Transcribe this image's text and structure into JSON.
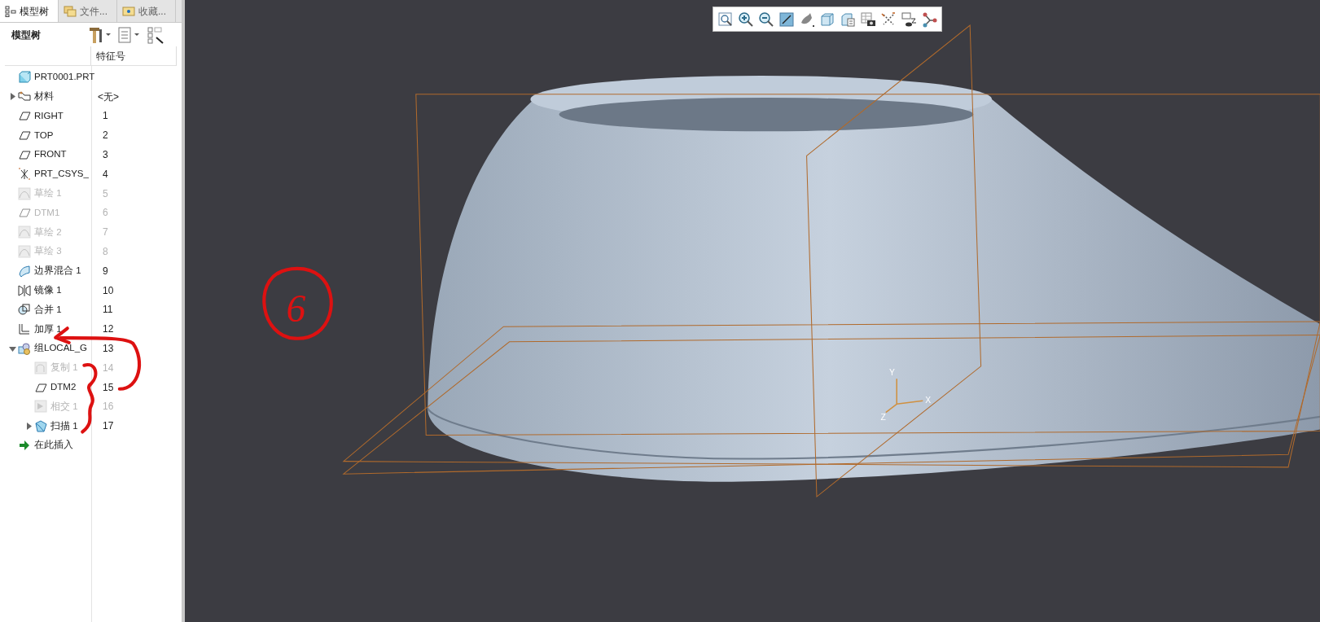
{
  "tabs": [
    {
      "label": "模型树",
      "selected": true
    },
    {
      "label": "文件...",
      "selected": false
    },
    {
      "label": "收藏...",
      "selected": false
    }
  ],
  "tree_toolbar": {
    "title": "模型树"
  },
  "tree": {
    "columns": [
      "特征号"
    ],
    "items": [
      {
        "kind": "part",
        "label": "PRT0001.PRT",
        "disabled": false
      },
      {
        "kind": "material",
        "label": "材料",
        "feature_no": "<无>",
        "disabled": false,
        "expanded": false
      },
      {
        "kind": "plane",
        "label": "RIGHT",
        "feature_no": "1",
        "disabled": false
      },
      {
        "kind": "plane",
        "label": "TOP",
        "feature_no": "2",
        "disabled": false
      },
      {
        "kind": "plane",
        "label": "FRONT",
        "feature_no": "3",
        "disabled": false
      },
      {
        "kind": "csys",
        "label": "PRT_CSYS_",
        "feature_no": "4",
        "disabled": false
      },
      {
        "kind": "sketch",
        "label": "草绘 1",
        "feature_no": "5",
        "disabled": true
      },
      {
        "kind": "plane",
        "label": "DTM1",
        "feature_no": "6",
        "disabled": true
      },
      {
        "kind": "sketch",
        "label": "草绘 2",
        "feature_no": "7",
        "disabled": true
      },
      {
        "kind": "sketch",
        "label": "草绘 3",
        "feature_no": "8",
        "disabled": true
      },
      {
        "kind": "blend",
        "label": "边界混合 1",
        "feature_no": "9",
        "disabled": false
      },
      {
        "kind": "mirror",
        "label": "镜像 1",
        "feature_no": "10",
        "disabled": false
      },
      {
        "kind": "merge",
        "label": "合并 1",
        "feature_no": "11",
        "disabled": false
      },
      {
        "kind": "thicken",
        "label": "加厚 1",
        "feature_no": "12",
        "disabled": false
      },
      {
        "kind": "group",
        "label": "组LOCAL_G",
        "feature_no": "13",
        "disabled": false,
        "expanded": true,
        "children": [
          {
            "kind": "copy",
            "label": "复制 1",
            "feature_no": "14",
            "disabled": true
          },
          {
            "kind": "plane",
            "label": "DTM2",
            "feature_no": "15",
            "disabled": false
          },
          {
            "kind": "intersect",
            "label": "相交 1",
            "feature_no": "16",
            "disabled": true
          },
          {
            "kind": "sweep",
            "label": "扫描 1",
            "feature_no": "17",
            "disabled": false,
            "expanded": false
          }
        ]
      },
      {
        "kind": "insert",
        "label": "在此插入",
        "disabled": false
      }
    ]
  },
  "viewport": {
    "axes": {
      "x": "X",
      "y": "Y",
      "z": "Z"
    }
  },
  "annotation": {
    "text": "6"
  }
}
